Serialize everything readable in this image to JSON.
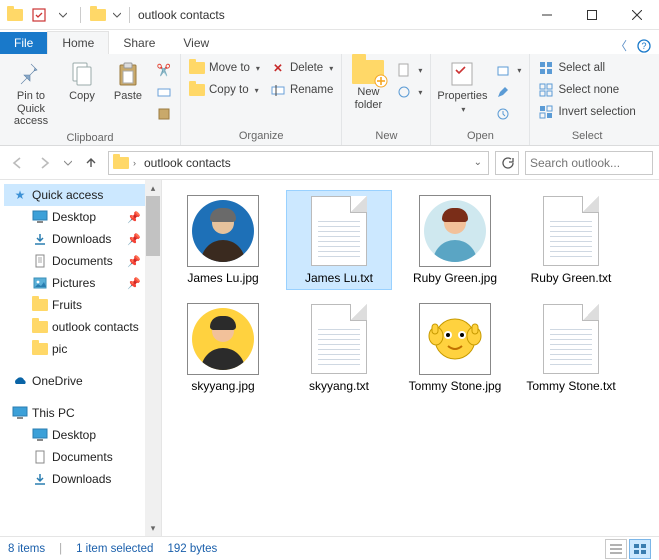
{
  "window": {
    "title": "outlook contacts"
  },
  "tabs": {
    "file": "File",
    "home": "Home",
    "share": "Share",
    "view": "View"
  },
  "ribbon": {
    "clipboard": {
      "label": "Clipboard",
      "pin": "Pin to Quick access",
      "copy": "Copy",
      "paste": "Paste"
    },
    "organize": {
      "label": "Organize",
      "move_to": "Move to",
      "copy_to": "Copy to",
      "delete": "Delete",
      "rename": "Rename"
    },
    "new": {
      "label": "New",
      "new_folder": "New folder"
    },
    "open": {
      "label": "Open",
      "properties": "Properties"
    },
    "select": {
      "label": "Select",
      "select_all": "Select all",
      "select_none": "Select none",
      "invert": "Invert selection"
    }
  },
  "address": {
    "crumb": "outlook contacts"
  },
  "search": {
    "placeholder": "Search outlook..."
  },
  "nav": {
    "quick_access": "Quick access",
    "desktop": "Desktop",
    "downloads": "Downloads",
    "documents": "Documents",
    "pictures": "Pictures",
    "fruits": "Fruits",
    "outlook_contacts": "outlook contacts",
    "pic": "pic",
    "onedrive": "OneDrive",
    "this_pc": "This PC",
    "desktop2": "Desktop",
    "documents2": "Documents",
    "downloads2": "Downloads"
  },
  "files": [
    {
      "name": "James Lu.jpg",
      "type": "jpg",
      "avatar": {
        "bg": "#1e70b7",
        "skin": "#e6c29c",
        "shirt": "#3a2a1f",
        "hair": "#6a6a6a"
      },
      "selected": false
    },
    {
      "name": "James Lu.txt",
      "type": "txt",
      "selected": true
    },
    {
      "name": "Ruby Green.jpg",
      "type": "jpg",
      "avatar": {
        "bg": "#cfe8ef",
        "skin": "#f2c19a",
        "shirt": "#5aa5c4",
        "hair": "#7a2d18"
      },
      "selected": false
    },
    {
      "name": "Ruby Green.txt",
      "type": "txt",
      "selected": false
    },
    {
      "name": "skyyang.jpg",
      "type": "jpg",
      "avatar": {
        "bg": "#ffd23f",
        "skin": "#f2c19a",
        "shirt": "#2b2b2b",
        "hair": "#2b2b2b"
      },
      "selected": false
    },
    {
      "name": "skyyang.txt",
      "type": "txt",
      "selected": false
    },
    {
      "name": "Tommy Stone.jpg",
      "type": "emoji",
      "selected": false
    },
    {
      "name": "Tommy Stone.txt",
      "type": "txt",
      "selected": false
    }
  ],
  "status": {
    "count": "8 items",
    "selection": "1 item selected",
    "size": "192 bytes"
  }
}
